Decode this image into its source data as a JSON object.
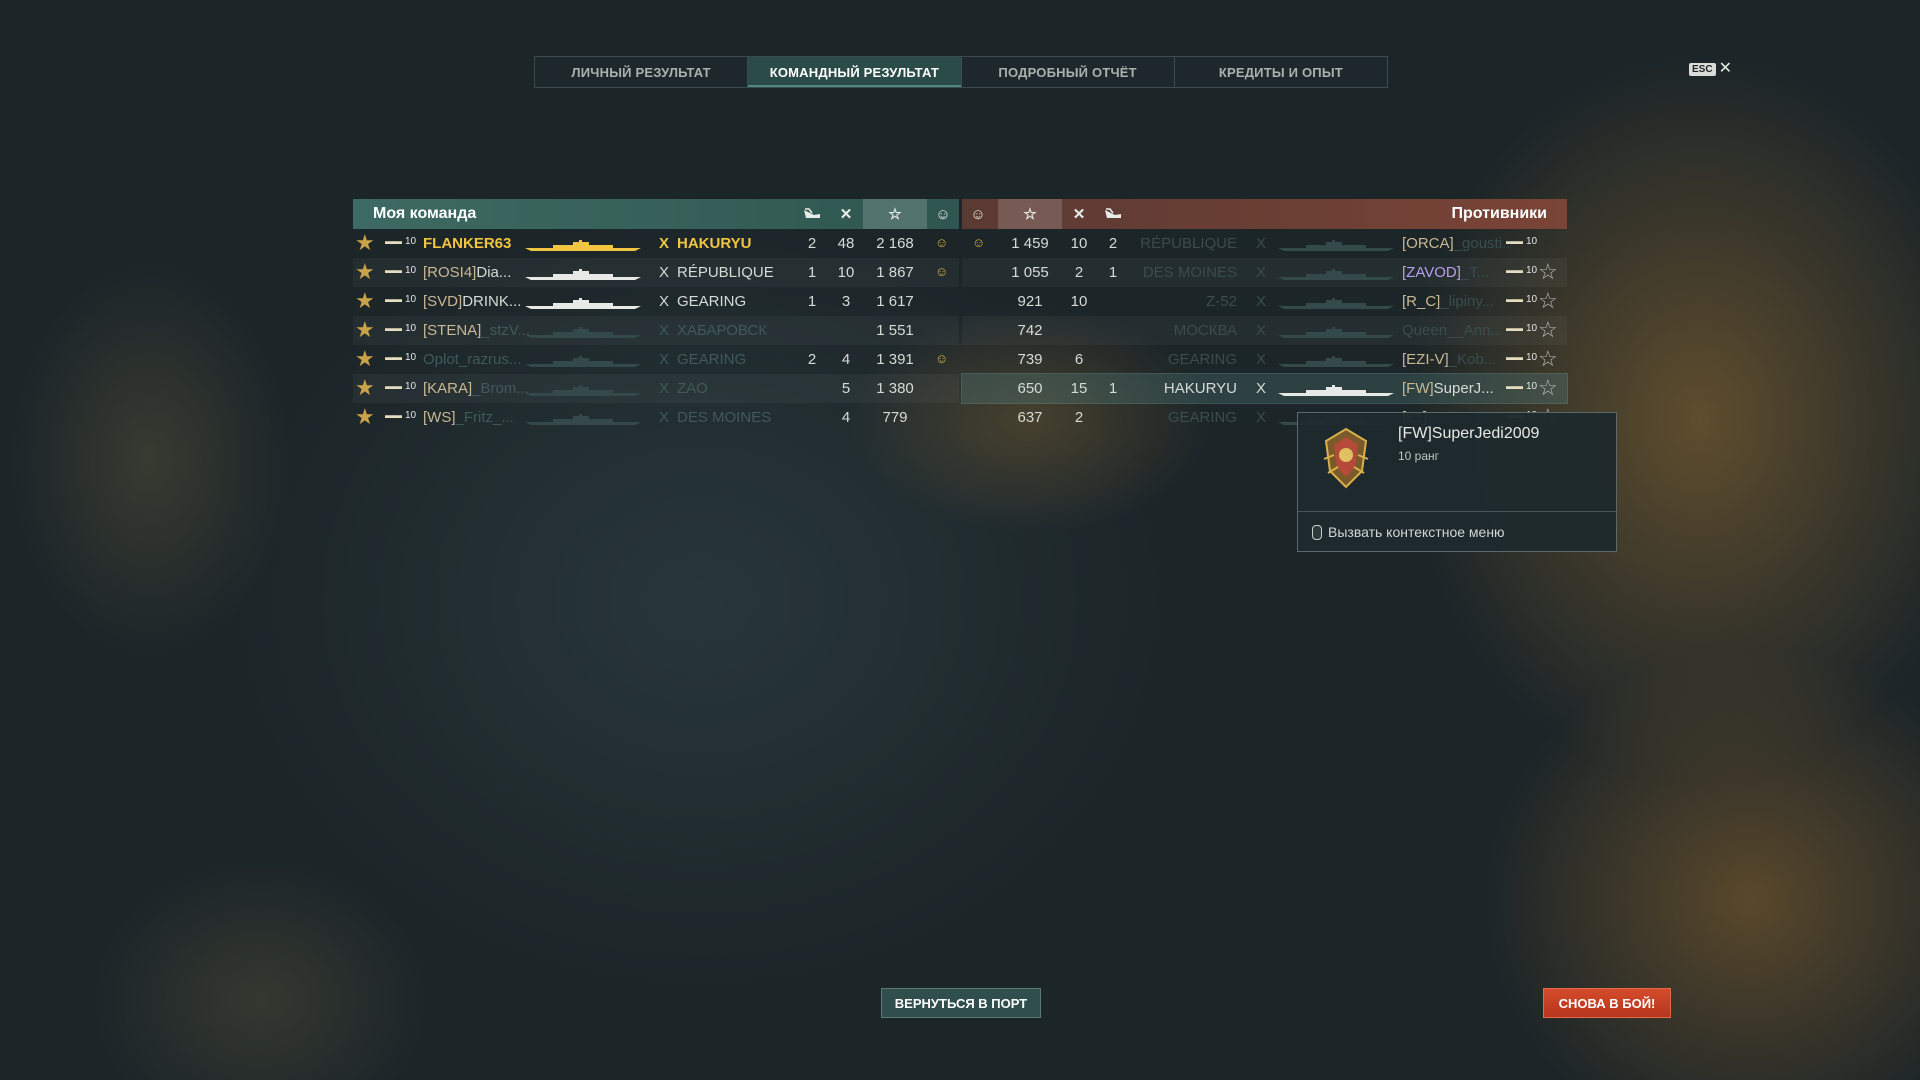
{
  "tabs": [
    "ЛИЧНЫЙ РЕЗУЛЬТАТ",
    "КОМАНДНЫЙ РЕЗУЛЬТАТ",
    "ПОДРОБНЫЙ ОТЧЁТ",
    "КРЕДИТЫ И ОПЫТ"
  ],
  "active_tab": "КОМАНДНЫЙ РЕЗУЛЬТАТ",
  "esc": {
    "key": "ESC",
    "icon": "close-icon"
  },
  "my_team": {
    "title": "Моя команда",
    "columns": [
      "planes-shot-icon",
      "kills-icon",
      "star-icon",
      "medal-icon"
    ],
    "rows": [
      {
        "tier": "10",
        "clan": "",
        "name": "FLANKER63",
        "x": "X",
        "ship": "HAKURYU",
        "planes": "2",
        "kills": "48",
        "score": "2 168",
        "medal": "☺",
        "style": "me"
      },
      {
        "tier": "10",
        "clan": "[ROSI4]",
        "name": "Dia...",
        "x": "X",
        "ship": "RÉPUBLIQUE",
        "planes": "1",
        "kills": "10",
        "score": "1 867",
        "medal": "☺",
        "style": "alive"
      },
      {
        "tier": "10",
        "clan": "[SVD]",
        "name": "DRINK...",
        "x": "X",
        "ship": "GEARING",
        "planes": "1",
        "kills": "3",
        "score": "1 617",
        "medal": "",
        "style": "alive"
      },
      {
        "tier": "10",
        "clan": "[STENA]",
        "name": "_stzV...",
        "x": "X",
        "ship": "ХАБАРОВСК",
        "planes": "",
        "kills": "",
        "score": "1 551",
        "medal": "",
        "style": "dead"
      },
      {
        "tier": "10",
        "clan": "",
        "name": "Oplot_razrus...",
        "x": "X",
        "ship": "GEARING",
        "planes": "2",
        "kills": "4",
        "score": "1 391",
        "medal": "☺",
        "style": "dead"
      },
      {
        "tier": "10",
        "clan": "[KARA]",
        "name": "_Brom...",
        "x": "X",
        "ship": "ZAO",
        "planes": "",
        "kills": "5",
        "score": "1 380",
        "medal": "",
        "style": "dead"
      },
      {
        "tier": "10",
        "clan": "[WS]",
        "name": "_Fritz_...",
        "x": "X",
        "ship": "DES MOINES",
        "planes": "",
        "kills": "4",
        "score": "779",
        "medal": "",
        "style": "dead"
      }
    ]
  },
  "enemies": {
    "title": "Противники",
    "columns": [
      "medal-icon",
      "star-icon",
      "kills-icon",
      "planes-shot-icon"
    ],
    "rows": [
      {
        "medal": "☺",
        "score": "1 459",
        "kills": "10",
        "planes": "2",
        "ship": "RÉPUBLIQUE",
        "x": "X",
        "clan": "[ORCA]",
        "name": "_gousti...",
        "tier": "10",
        "style": "dead"
      },
      {
        "medal": "",
        "score": "1 055",
        "kills": "2",
        "planes": "1",
        "ship": "DES MOINES",
        "x": "X",
        "clan": "[ZAVOD]",
        "name": "_T...",
        "tier": "10",
        "style": "dead"
      },
      {
        "medal": "",
        "score": "921",
        "kills": "10",
        "planes": "",
        "ship": "Z-52",
        "x": "X",
        "clan": "[R_C]",
        "name": "_lipiny...",
        "tier": "10",
        "style": "dead"
      },
      {
        "medal": "",
        "score": "742",
        "kills": "",
        "planes": "",
        "ship": "МОСКВА",
        "x": "X",
        "clan": "",
        "name": "Queen__Ann...",
        "tier": "10",
        "style": "dead"
      },
      {
        "medal": "",
        "score": "739",
        "kills": "6",
        "planes": "",
        "ship": "GEARING",
        "x": "X",
        "clan": "[EZI-V]",
        "name": "_Kob...",
        "tier": "10",
        "style": "dead"
      },
      {
        "medal": "",
        "score": "650",
        "kills": "15",
        "planes": "1",
        "ship": "HAKURYU",
        "x": "X",
        "clan": "[FW]",
        "name": "SuperJ...",
        "tier": "10",
        "style": "hl"
      },
      {
        "medal": "",
        "score": "637",
        "kills": "2",
        "planes": "",
        "ship": "GEARING",
        "x": "X",
        "clan": "[81]",
        "name": "",
        "tier": "10",
        "style": "dead"
      }
    ]
  },
  "tooltip": {
    "name": "[FW]SuperJedi2009",
    "rank": "10 ранг",
    "hint": "Вызвать контекстное меню"
  },
  "buttons": {
    "port": "ВЕРНУТЬСЯ В ПОРТ",
    "battle": "СНОВА В БОЙ!"
  },
  "colors": {
    "player_highlight": "#f0c542",
    "battle_button": "#c8401f",
    "ally_header": "#3d6a62",
    "enemy_header": "#6a3e34"
  }
}
